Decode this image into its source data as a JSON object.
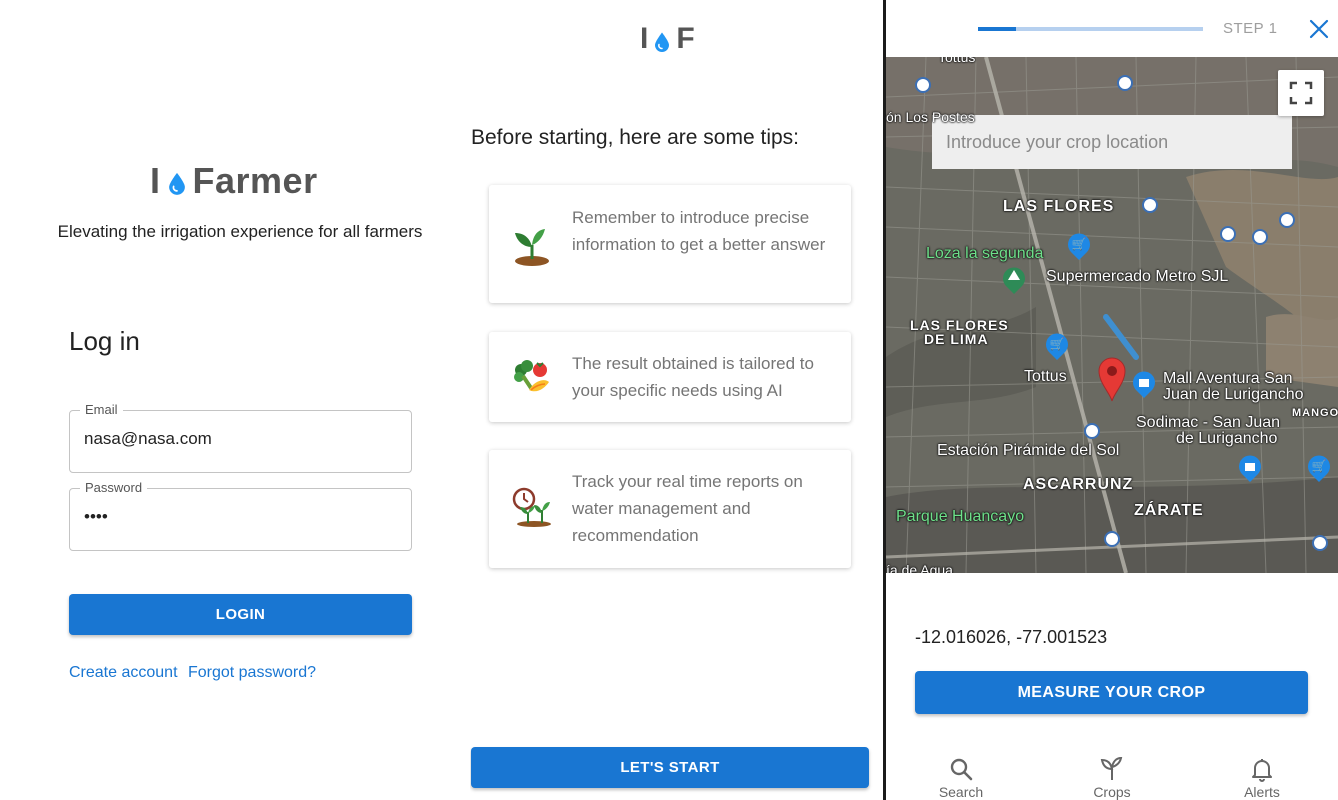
{
  "login": {
    "brand_left": "I",
    "brand_right": "Farmer",
    "tagline": "Elevating the irrigation experience for all farmers",
    "title": "Log in",
    "email_label": "Email",
    "email_value": "nasa@nasa.com",
    "password_label": "Password",
    "password_value": "••••",
    "login_button": "LOGIN",
    "create_account": "Create account",
    "forgot_password": "Forgot password?"
  },
  "tips": {
    "brand_left": "I",
    "brand_right": "F",
    "title": "Before starting, here are some tips:",
    "items": [
      {
        "text": "Remember to introduce precise information to get a better answer",
        "icon": "sprout-icon"
      },
      {
        "text": "The result obtained is tailored to your specific needs using AI",
        "icon": "vegetables-icon"
      },
      {
        "text": "Track your real time reports on water management and recommendation",
        "icon": "clock-plants-icon"
      }
    ],
    "start_button": "LET'S START"
  },
  "map_screen": {
    "progress": 0.17,
    "step_label": "STEP 1",
    "search_placeholder": "Introduce your crop location",
    "map_labels": {
      "top_left_1": "Tottus",
      "top_left_2": "ón Los Postes",
      "las_flores": "LAS FLORES",
      "loza": "Loza la segunda",
      "metro": "Supermercado Metro SJL",
      "las_flores_lima_1": "LAS FLORES",
      "las_flores_lima_2": "DE LIMA",
      "tottus": "Tottus",
      "mall_1": "Mall Aventura San",
      "mall_2": "Juan de Lurigancho",
      "mango": "MANGO",
      "sodimac_1": "Sodimac - San Juan",
      "sodimac_2": "de Lurigancho",
      "estacion": "Estación Pirámide del Sol",
      "ascarrunz": "ASCARRUNZ",
      "zarate": "ZÁRATE",
      "parque": "Parque Huancayo",
      "agua": "ía de Agua"
    },
    "coordinates": "-12.016026, -77.001523",
    "measure_button": "MEASURE YOUR CROP",
    "nav": {
      "search": "Search",
      "crops": "Crops",
      "alerts": "Alerts"
    },
    "colors": {
      "primary": "#1976d2",
      "progress_track": "#b6d0ef",
      "marker": "#e53935"
    }
  }
}
